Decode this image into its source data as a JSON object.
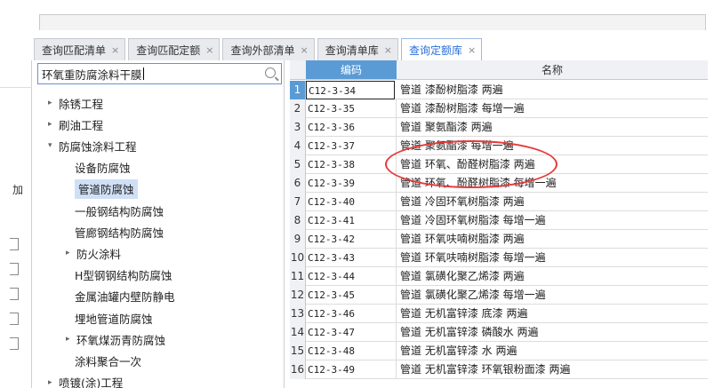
{
  "tabs": [
    {
      "label": "查询匹配清单",
      "active": false
    },
    {
      "label": "查询匹配定额",
      "active": false
    },
    {
      "label": "查询外部清单",
      "active": false
    },
    {
      "label": "查询清单库",
      "active": false
    },
    {
      "label": "查询定额库",
      "active": true
    }
  ],
  "leftstrip": {
    "label": "加"
  },
  "search": {
    "value": "环氧重防腐涂料干膜"
  },
  "tree": [
    {
      "label": "除锈工程",
      "arrow": "▸",
      "level": 0
    },
    {
      "label": "刷油工程",
      "arrow": "▸",
      "level": 0
    },
    {
      "label": "防腐蚀涂料工程",
      "arrow": "▾",
      "level": 0
    },
    {
      "label": "设备防腐蚀",
      "arrow": "",
      "level": 1
    },
    {
      "label": "管道防腐蚀",
      "arrow": "",
      "level": 1,
      "selected": true
    },
    {
      "label": "一般钢结构防腐蚀",
      "arrow": "",
      "level": 1
    },
    {
      "label": "管廊钢结构防腐蚀",
      "arrow": "",
      "level": 1
    },
    {
      "label": "防火涂料",
      "arrow": "▸",
      "level": 1
    },
    {
      "label": "H型钢钢结构防腐蚀",
      "arrow": "",
      "level": 1
    },
    {
      "label": "金属油罐内壁防静电",
      "arrow": "",
      "level": 1
    },
    {
      "label": "埋地管道防腐蚀",
      "arrow": "",
      "level": 1
    },
    {
      "label": "环氧煤沥青防腐蚀",
      "arrow": "▸",
      "level": 1
    },
    {
      "label": "涂料聚合一次",
      "arrow": "",
      "level": 1
    },
    {
      "label": "喷镀(涂)工程",
      "arrow": "▸",
      "level": 0
    }
  ],
  "grid": {
    "headers": {
      "code": "编码",
      "name": "名称"
    },
    "rows": [
      {
        "num": "1",
        "code": "C12-3-34",
        "name": "管道 漆酚树脂漆 两遍"
      },
      {
        "num": "2",
        "code": "C12-3-35",
        "name": "管道 漆酚树脂漆 每增一遍"
      },
      {
        "num": "3",
        "code": "C12-3-36",
        "name": "管道 聚氨酯漆 两遍"
      },
      {
        "num": "4",
        "code": "C12-3-37",
        "name": "管道 聚氨酯漆 每增一遍"
      },
      {
        "num": "5",
        "code": "C12-3-38",
        "name": "管道 环氧、酚醛树脂漆 两遍"
      },
      {
        "num": "6",
        "code": "C12-3-39",
        "name": "管道 环氧、酚醛树脂漆 每增一遍"
      },
      {
        "num": "7",
        "code": "C12-3-40",
        "name": "管道 冷固环氧树脂漆 两遍"
      },
      {
        "num": "8",
        "code": "C12-3-41",
        "name": "管道 冷固环氧树脂漆 每增一遍"
      },
      {
        "num": "9",
        "code": "C12-3-42",
        "name": "管道 环氧呋喃树脂漆 两遍"
      },
      {
        "num": "10",
        "code": "C12-3-43",
        "name": "管道 环氧呋喃树脂漆 每增一遍"
      },
      {
        "num": "11",
        "code": "C12-3-44",
        "name": "管道 氯磺化聚乙烯漆 两遍"
      },
      {
        "num": "12",
        "code": "C12-3-45",
        "name": "管道 氯磺化聚乙烯漆 每增一遍"
      },
      {
        "num": "13",
        "code": "C12-3-46",
        "name": "管道 无机富锌漆 底漆 两遍"
      },
      {
        "num": "14",
        "code": "C12-3-47",
        "name": "管道 无机富锌漆 磷酸水 两遍"
      },
      {
        "num": "15",
        "code": "C12-3-48",
        "name": "管道 无机富锌漆 水 两遍"
      },
      {
        "num": "16",
        "code": "C12-3-49",
        "name": "管道 无机富锌漆 环氧银粉面漆 两遍"
      }
    ]
  },
  "colors": {
    "accent": "#5b9bd5",
    "annotation": "#e63a3a",
    "selected": "#cfe0f6"
  }
}
